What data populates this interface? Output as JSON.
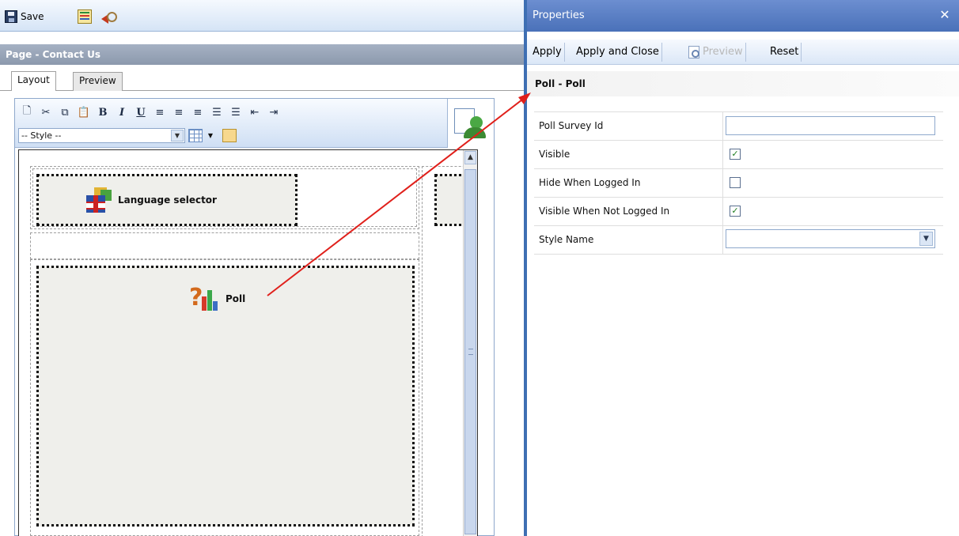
{
  "editor": {
    "toolbar": {
      "save_label": "Save"
    },
    "page_title": "Page - Contact Us",
    "tabs": [
      {
        "label": "Layout",
        "active": true
      },
      {
        "label": "Preview",
        "active": false
      }
    ],
    "rte": {
      "style_dropdown": "-- Style --",
      "format_buttons": [
        "new-document",
        "cut",
        "copy",
        "paste",
        "bold",
        "italic",
        "underline",
        "align-left",
        "align-center",
        "align-right",
        "numbered-list",
        "bulleted-list",
        "outdent",
        "indent"
      ]
    },
    "controls": [
      {
        "label": "Language selector",
        "icon": "uk-flag-icon"
      },
      {
        "label": "Poll",
        "icon": "poll-icon"
      }
    ]
  },
  "properties": {
    "title": "Properties",
    "toolbar": {
      "apply": "Apply",
      "apply_close": "Apply and Close",
      "preview": "Preview",
      "reset": "Reset"
    },
    "section": "Poll - Poll",
    "rows": [
      {
        "label": "Poll Survey Id",
        "type": "text",
        "value": ""
      },
      {
        "label": "Visible",
        "type": "checkbox",
        "checked": true
      },
      {
        "label": "Hide When Logged In",
        "type": "checkbox",
        "checked": false
      },
      {
        "label": "Visible When Not Logged In",
        "type": "checkbox",
        "checked": true
      },
      {
        "label": "Style Name",
        "type": "select",
        "value": ""
      }
    ]
  },
  "colors": {
    "annotation_arrow": "#e0201b",
    "properties_title_bg": "#5a7fc4",
    "page_title_bg": "#97a3b6"
  }
}
